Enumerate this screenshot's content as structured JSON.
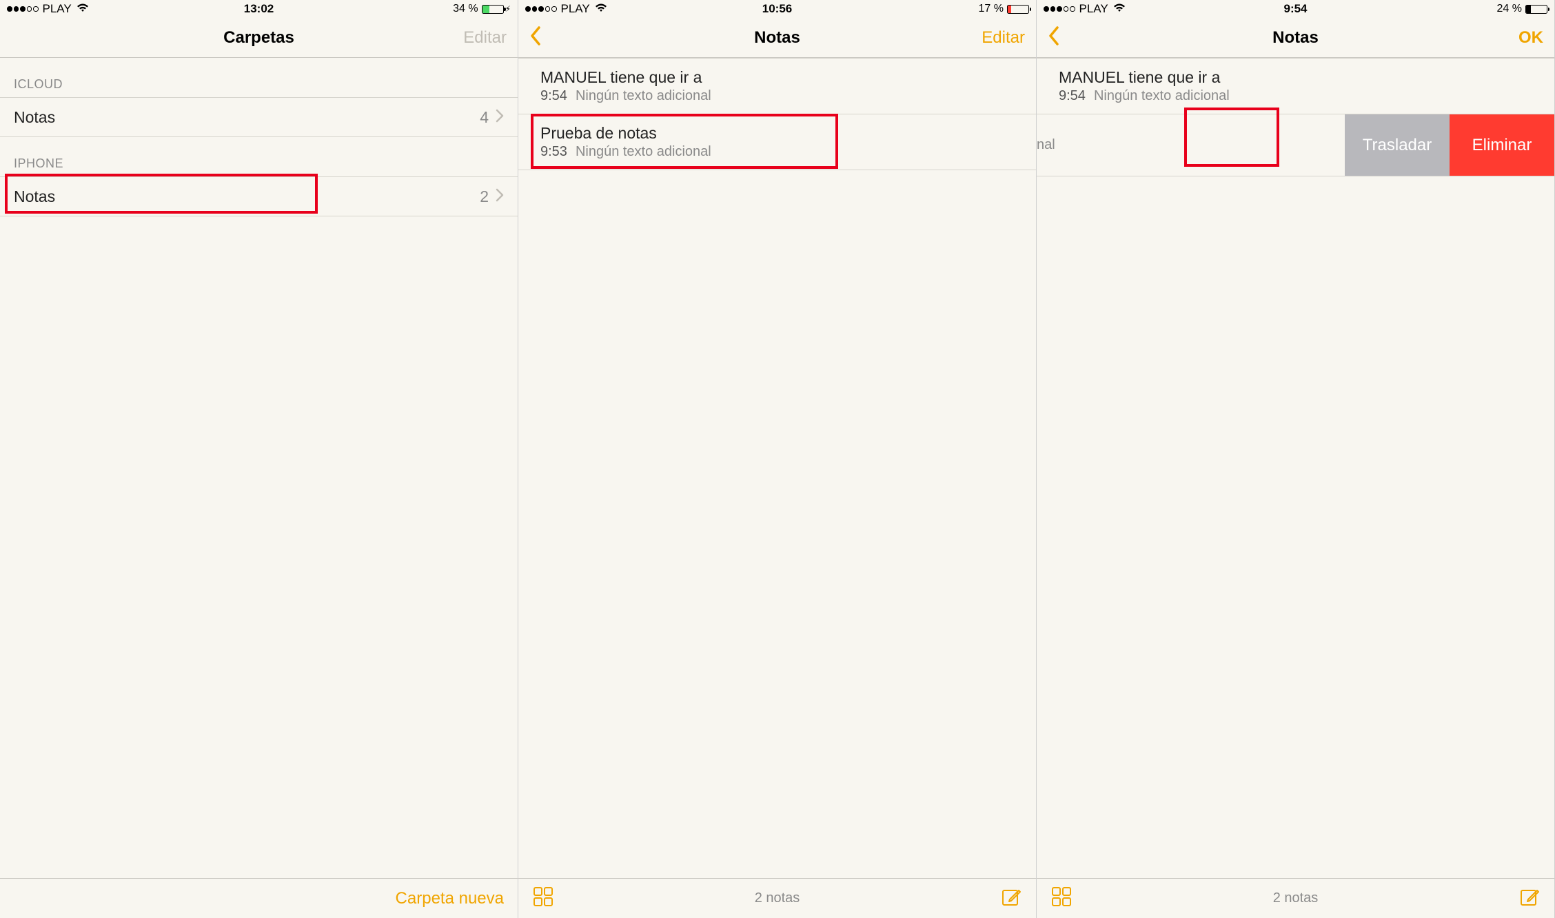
{
  "status": {
    "carrier": "PLAY"
  },
  "screens": {
    "s1": {
      "time": "13:02",
      "battery_pct": "34 %",
      "nav_title": "Carpetas",
      "edit_label": "Editar",
      "sections": [
        {
          "header": "ICLOUD",
          "folder_label": "Notas",
          "count": "4"
        },
        {
          "header": "IPHONE",
          "folder_label": "Notas",
          "count": "2"
        }
      ],
      "toolbar_right": "Carpeta nueva"
    },
    "s2": {
      "time": "10:56",
      "battery_pct": "17 %",
      "nav_title": "Notas",
      "edit_label": "Editar",
      "notes": [
        {
          "title": "MANUEL tiene que ir a",
          "time": "9:54",
          "subtitle": "Ningún texto adicional"
        },
        {
          "title": "Prueba de notas",
          "time": "9:53",
          "subtitle": "Ningún texto adicional"
        }
      ],
      "toolbar_center": "2 notas"
    },
    "s3": {
      "time": "9:54",
      "battery_pct": "24 %",
      "nav_title": "Notas",
      "ok_label": "OK",
      "note1": {
        "title": "MANUEL tiene que ir a",
        "time": "9:54",
        "subtitle": "Ningún texto adicional"
      },
      "swipe_peek": "nal",
      "move_label": "Trasladar",
      "delete_label": "Eliminar",
      "toolbar_center": "2 notas"
    }
  }
}
